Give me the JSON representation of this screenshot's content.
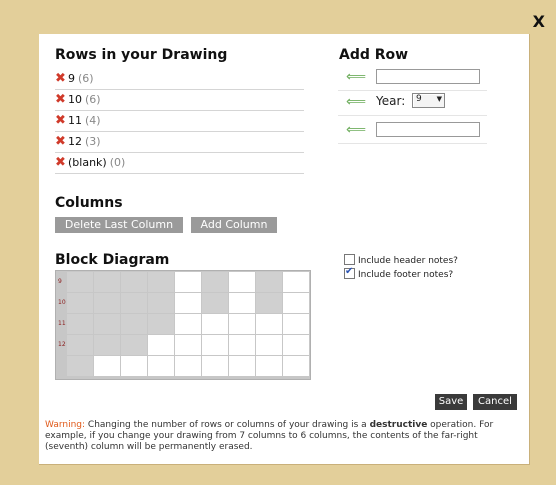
{
  "close_label": "X",
  "rows_section": {
    "title": "Rows in your Drawing",
    "items": [
      {
        "label": "9",
        "count": "(6)"
      },
      {
        "label": "10",
        "count": "(6)"
      },
      {
        "label": "11",
        "count": "(4)"
      },
      {
        "label": "12",
        "count": "(3)"
      },
      {
        "label": "(blank)",
        "count": "(0)"
      }
    ],
    "delete_icon": "✖"
  },
  "add_row": {
    "title": "Add Row",
    "arrow_icon": "⟸",
    "year_label": "Year:",
    "year_value": "9"
  },
  "columns": {
    "title": "Columns",
    "delete_label": "Delete Last Column",
    "add_label": "Add Column"
  },
  "block_diagram": {
    "title": "Block Diagram",
    "row_labels": [
      "9",
      "10",
      "11",
      "12",
      ""
    ],
    "columns": 8,
    "filled": [
      [
        1,
        1,
        1,
        1,
        0,
        1,
        0,
        1,
        0
      ],
      [
        1,
        1,
        1,
        1,
        0,
        1,
        0,
        1,
        0
      ],
      [
        1,
        1,
        1,
        1,
        0,
        0,
        0,
        0,
        0
      ],
      [
        1,
        1,
        1,
        0,
        0,
        0,
        0,
        0,
        0
      ],
      [
        1,
        0,
        0,
        0,
        0,
        0,
        0,
        0,
        0
      ]
    ]
  },
  "options": {
    "header_notes": {
      "label": "Include header notes?",
      "checked": false
    },
    "footer_notes": {
      "label": "Include footer notes?",
      "checked": true
    }
  },
  "buttons": {
    "save": "Save",
    "cancel": "Cancel"
  },
  "warning": {
    "label": "Warning:",
    "text_before": " Changing the number of rows or columns of your drawing is a ",
    "emphasis": "destructive",
    "text_after": " operation. For example, if you change your drawing from 7 columns to 6 columns, the contents of the far-right (seventh) column will be permanently erased."
  }
}
